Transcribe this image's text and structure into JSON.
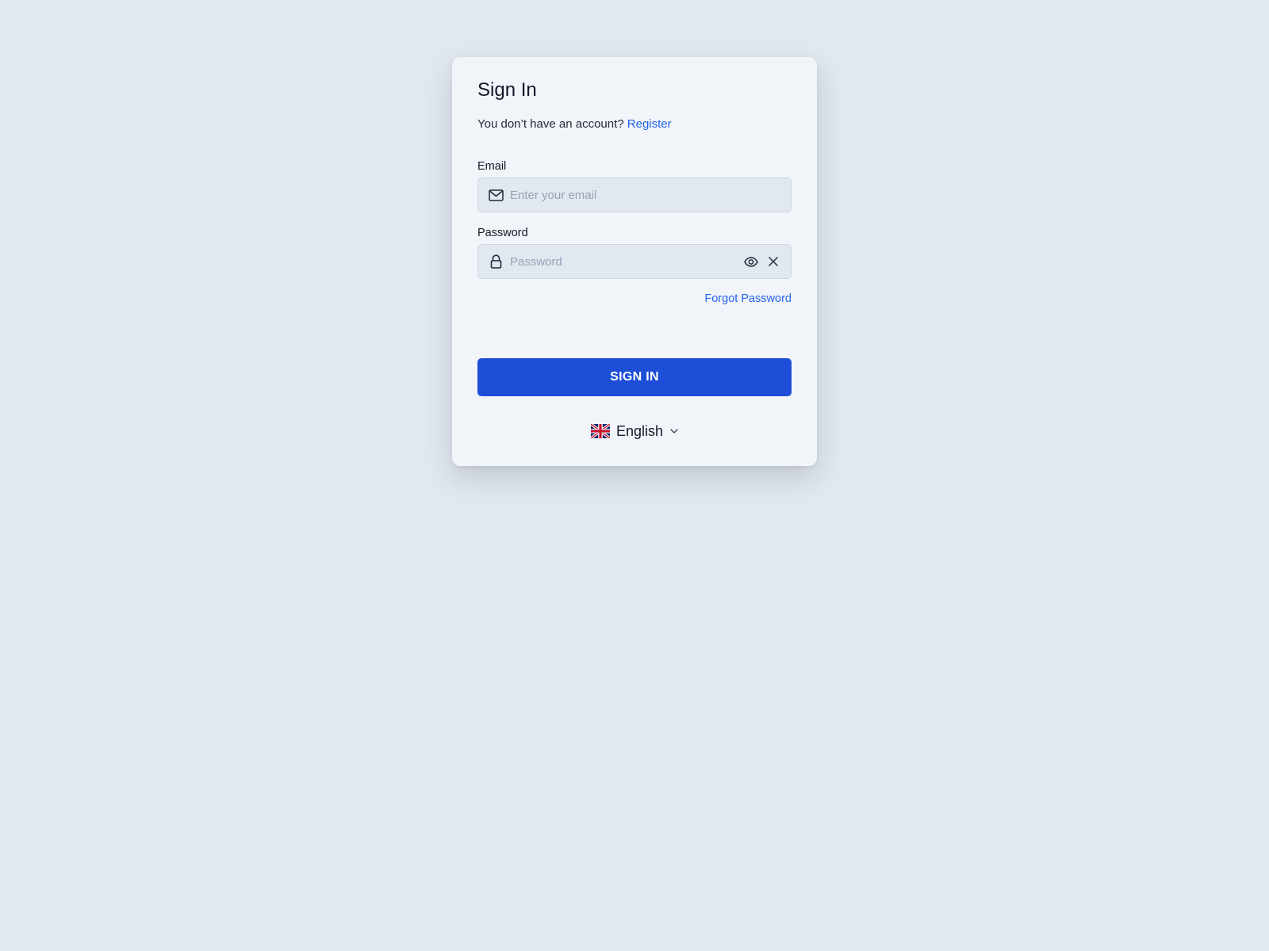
{
  "signin": {
    "title": "Sign In",
    "subtitle_text": "You don’t have an account?",
    "register_link": "Register",
    "email": {
      "label": "Email",
      "placeholder": "Enter your email",
      "icon": "mail-icon"
    },
    "password": {
      "label": "Password",
      "placeholder": "Password",
      "icon": "lock-icon",
      "toggle_icon": "eye-icon",
      "clear_icon": "close-icon"
    },
    "forgot_link": "Forgot Password",
    "submit_label": "SIGN IN",
    "language": {
      "selected": "English",
      "flag": "uk-flag-icon",
      "dropdown_icon": "chevron-down-icon"
    }
  },
  "colors": {
    "page_background": "#e2e8f0",
    "card_background": "#f1f5f9",
    "input_background": "#e2e8f0",
    "link": "#2563eb",
    "primary_button": "#1d4ed8",
    "primary_button_text": "#ffffff",
    "text": "#111827",
    "placeholder": "#94a3b8"
  }
}
